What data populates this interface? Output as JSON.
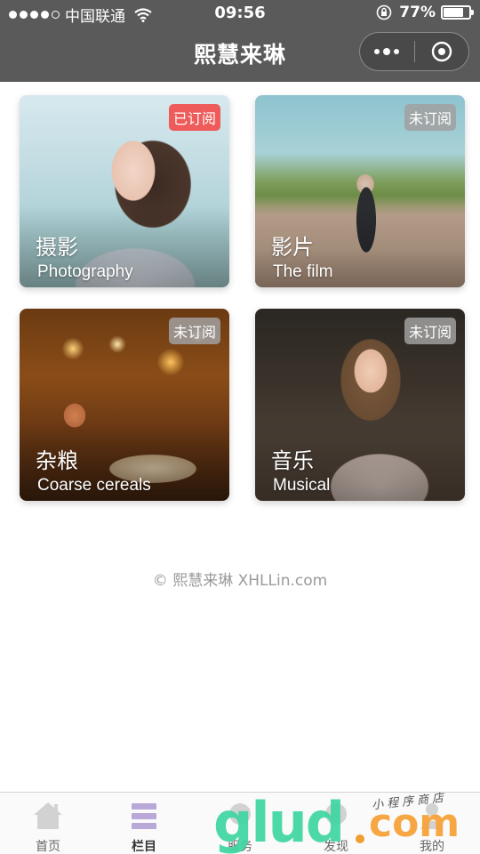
{
  "status_bar": {
    "carrier": "中国联通",
    "time": "09:56",
    "battery_percent": "77%",
    "battery_level": 0.77,
    "signal_bars": 4,
    "signal_max": 5
  },
  "nav": {
    "title": "熙慧来琳"
  },
  "cards": [
    {
      "cn": "摄影",
      "en": "Photography",
      "badge": "已订阅",
      "subscribed": true
    },
    {
      "cn": "影片",
      "en": "The film",
      "badge": "未订阅",
      "subscribed": false
    },
    {
      "cn": "杂粮",
      "en": "Coarse cereals",
      "badge": "未订阅",
      "subscribed": false
    },
    {
      "cn": "音乐",
      "en": "Musical",
      "badge": "未订阅",
      "subscribed": false
    }
  ],
  "copyright": "© 熙慧来琳 XHLLin.com",
  "tabbar": {
    "items": [
      {
        "label": "首页",
        "icon": "home-icon",
        "active": false
      },
      {
        "label": "栏目",
        "icon": "menu-icon",
        "active": true
      },
      {
        "label": "服务",
        "icon": "service-icon",
        "active": false
      },
      {
        "label": "发现",
        "icon": "discover-icon",
        "active": false
      },
      {
        "label": "我的",
        "icon": "user-icon",
        "active": false
      }
    ]
  },
  "watermark": {
    "brand": "glud",
    "tld": "com",
    "tagline": "小程序商店"
  },
  "colors": {
    "header": "#5a5a5a",
    "subscribed_badge": "#ef5a5a",
    "unsubscribed_badge": "#a0a0a0",
    "tab_active_icon": "#b9a8d8",
    "tab_inactive_icon": "#d2d2d2"
  }
}
